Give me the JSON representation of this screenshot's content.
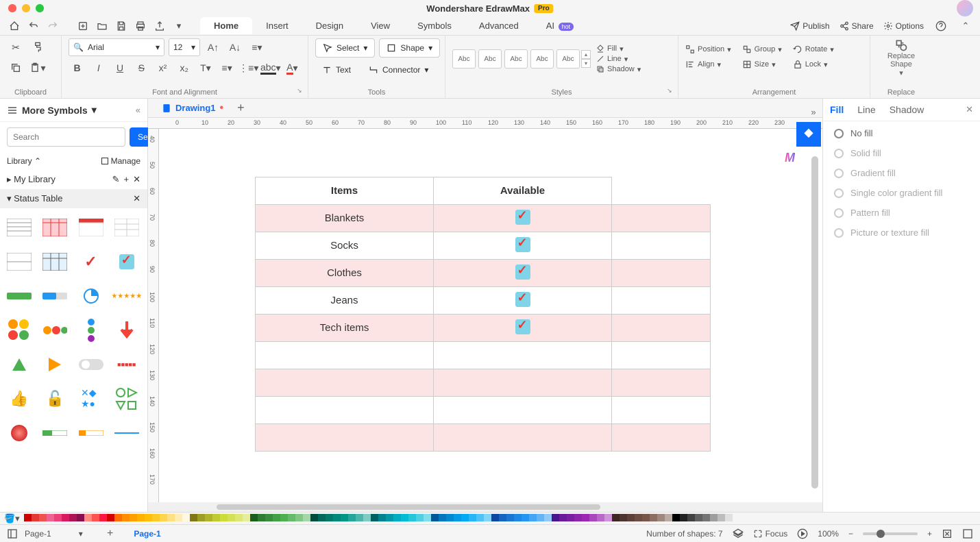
{
  "app": {
    "title": "Wondershare EdrawMax",
    "badge": "Pro"
  },
  "menu": {
    "tabs": [
      "Home",
      "Insert",
      "Design",
      "View",
      "Symbols",
      "Advanced"
    ],
    "ai": "AI",
    "hot": "hot",
    "right": {
      "publish": "Publish",
      "share": "Share",
      "options": "Options"
    }
  },
  "ribbon": {
    "font": "Arial",
    "size": "12",
    "select": "Select",
    "shape": "Shape",
    "text": "Text",
    "connector": "Connector",
    "style_sample": "Abc",
    "fill": "Fill",
    "line": "Line",
    "shadow": "Shadow",
    "position": "Position",
    "align": "Align",
    "group": "Group",
    "size_label": "Size",
    "rotate": "Rotate",
    "lock": "Lock",
    "replace_shape": "Replace Shape",
    "groups": {
      "clipboard": "Clipboard",
      "font": "Font and Alignment",
      "tools": "Tools",
      "styles": "Styles",
      "arrangement": "Arrangement",
      "replace": "Replace"
    }
  },
  "sidebar": {
    "title": "More Symbols",
    "search_placeholder": "Search",
    "search_btn": "Search",
    "library": "Library",
    "manage": "Manage",
    "my_library": "My Library",
    "section": "Status Table"
  },
  "doc": {
    "tab": "Drawing1"
  },
  "ruler_h": [
    "0",
    "10",
    "20",
    "30",
    "40",
    "50",
    "60",
    "70",
    "80",
    "90",
    "100",
    "110",
    "120",
    "130",
    "140",
    "150",
    "160",
    "170",
    "180",
    "190",
    "200",
    "210",
    "220",
    "230"
  ],
  "ruler_v": [
    "40",
    "50",
    "60",
    "70",
    "80",
    "90",
    "100",
    "110",
    "120",
    "130",
    "140",
    "150",
    "160",
    "170"
  ],
  "table": {
    "headers": [
      "Items",
      "Available"
    ],
    "rows": [
      {
        "item": "Blankets",
        "checked": true
      },
      {
        "item": "Socks",
        "checked": true
      },
      {
        "item": "Clothes",
        "checked": true
      },
      {
        "item": "Jeans",
        "checked": true
      },
      {
        "item": "Tech items",
        "checked": true
      },
      {
        "item": "",
        "checked": false
      },
      {
        "item": "",
        "checked": false
      },
      {
        "item": "",
        "checked": false
      },
      {
        "item": "",
        "checked": false
      }
    ]
  },
  "right": {
    "tabs": {
      "fill": "Fill",
      "line": "Line",
      "shadow": "Shadow"
    },
    "options": [
      "No fill",
      "Solid fill",
      "Gradient fill",
      "Single color gradient fill",
      "Pattern fill",
      "Picture or texture fill"
    ]
  },
  "colorbar": [
    "#cc0000",
    "#e53935",
    "#ef5350",
    "#f06292",
    "#ec407a",
    "#d81b60",
    "#ad1457",
    "#880e4f",
    "#ff8a80",
    "#ff5252",
    "#ff1744",
    "#d50000",
    "#ff6f00",
    "#ff8f00",
    "#ffa000",
    "#ffb300",
    "#ffc107",
    "#ffca28",
    "#ffd54f",
    "#ffe082",
    "#ffecb3",
    "#fff8e1",
    "#827717",
    "#9e9d24",
    "#afb42b",
    "#c0ca33",
    "#cddc39",
    "#d4e157",
    "#dce775",
    "#e6ee9c",
    "#1b5e20",
    "#2e7d32",
    "#388e3c",
    "#43a047",
    "#4caf50",
    "#66bb6a",
    "#81c784",
    "#a5d6a7",
    "#004d40",
    "#00695c",
    "#00796b",
    "#00897b",
    "#009688",
    "#26a69a",
    "#4db6ac",
    "#80cbc4",
    "#006064",
    "#00838f",
    "#0097a7",
    "#00acc1",
    "#00bcd4",
    "#26c6da",
    "#4dd0e1",
    "#80deea",
    "#01579b",
    "#0277bd",
    "#0288d1",
    "#039be5",
    "#03a9f4",
    "#29b6f6",
    "#4fc3f7",
    "#81d4fa",
    "#0d47a1",
    "#1565c0",
    "#1976d2",
    "#1e88e5",
    "#2196f3",
    "#42a5f5",
    "#64b5f6",
    "#90caf9",
    "#4a148c",
    "#6a1b9a",
    "#7b1fa2",
    "#8e24aa",
    "#9c27b0",
    "#ab47bc",
    "#ba68c8",
    "#ce93d8",
    "#3e2723",
    "#4e342e",
    "#5d4037",
    "#6d4c41",
    "#795548",
    "#8d6e63",
    "#a1887f",
    "#bcaaa4",
    "#000000",
    "#212121",
    "#424242",
    "#616161",
    "#757575",
    "#9e9e9e",
    "#bdbdbd",
    "#e0e0e0"
  ],
  "status": {
    "page_select": "Page-1",
    "page_tab": "Page-1",
    "shapes": "Number of shapes: 7",
    "focus": "Focus",
    "zoom": "100%"
  }
}
